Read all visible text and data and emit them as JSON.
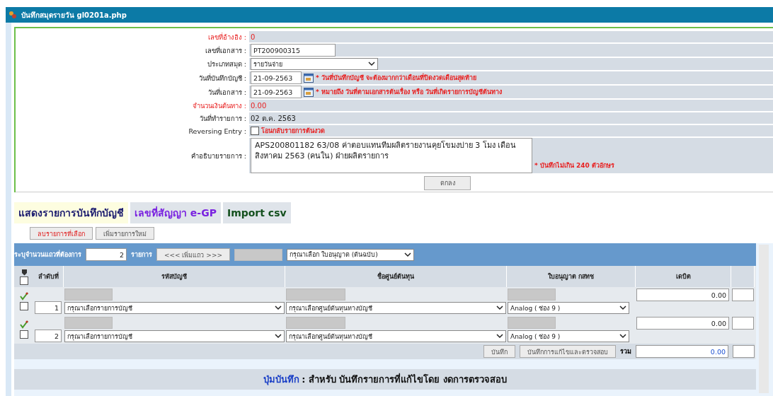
{
  "window": {
    "title": "บันทึกสมุดรายวัน gl0201a.php"
  },
  "form": {
    "fields": [
      {
        "kind": "readonly",
        "label": "เลขที่อ้างอิง :",
        "value": "0",
        "alert": true
      },
      {
        "kind": "input",
        "label": "เลขที่เอกสาร :",
        "value": "PT200900315"
      },
      {
        "kind": "select",
        "label": "ประเภทสมุด :",
        "value": "รายวันจ่าย"
      },
      {
        "kind": "date",
        "label": "วันที่บันทึกบัญชี :",
        "value": "21-09-2563",
        "note": "* วันที่บันทึกบัญชี จะต้องมากกว่าเดือนที่ปิดงวดเดือนสุดท้าย"
      },
      {
        "kind": "date",
        "label": "วันที่เอกสาร :",
        "value": "21-09-2563",
        "note": "* หมายถึง วันที่ตามเอกสารต้นเรื่อง หรือ วันที่เกิดรายการบัญชีต้นทาง"
      },
      {
        "kind": "readonly",
        "label": "จำนวนเงินต้นทาง :",
        "value": "0.00",
        "alert": true
      },
      {
        "kind": "readonly",
        "label": "วันที่ทำรายการ :",
        "value": "02 ต.ค. 2563",
        "alert": false
      },
      {
        "kind": "checkbox",
        "label": "Reversing Entry :",
        "checked": false,
        "caption": "โอนกลับรายการต้นงวด"
      },
      {
        "kind": "textarea",
        "label": "คำอธิบายรายการ :",
        "value": "APS200801182 63/08 ค่าตอบแทนทีมผลิตรายงานคุยโขมงบ่าย 3 โมง เดือนสิงหาคม 2563 (คนใน) ฝ่ายผลิตรายการ",
        "note": "* บันทึกไม่เกิน 240 ตัวอักษร"
      }
    ],
    "submit": "ตกลง"
  },
  "tabs": [
    {
      "label": "แสดงรายการบันทึกบัญชี",
      "selected": true,
      "color": "#1a1a6e"
    },
    {
      "label": "เลขที่สัญญา e-GP",
      "selected": false,
      "color": "#7a22e0"
    },
    {
      "label": "Import csv",
      "selected": false,
      "color": "#14501e"
    }
  ],
  "actions": [
    {
      "label": "ลบรายการที่เลือก",
      "kind": "danger"
    },
    {
      "label": "เพิ่มรายการใหม่",
      "kind": "normal"
    }
  ],
  "row_adder": {
    "label": "ระบุจำนวนแถวที่ต้องการ",
    "count": "2",
    "unit": "รายการ",
    "button": "<<< เพิ่มแถว >>>",
    "license_select": "กรุณาเลือก ใบอนุญาต (ต้นฉบับ)"
  },
  "table": {
    "select_all": false,
    "columns": [
      "ลำดับที่",
      "รหัสบัญชี",
      "ชื่อศูนย์ต้นทุน",
      "ใบอนุญาต กสทช",
      "เดบิต"
    ],
    "rows": [
      {
        "checked": false,
        "number": "1",
        "account": "กรุณาเลือกรายการบัญชี",
        "cost_center": "กรุณาเลือกศูนย์ต้นทุนทางบัญชี",
        "license": "Analog ( ช่อง 9 )",
        "debit": "0.00"
      },
      {
        "checked": false,
        "number": "2",
        "account": "กรุณาเลือกรายการบัญชี",
        "cost_center": "กรุณาเลือกศูนย์ต้นทุนทางบัญชี",
        "license": "Analog ( ช่อง 9 )",
        "debit": "0.00"
      }
    ],
    "footer": {
      "buttons": [
        "บันทึก",
        "บันทึกการแก้ไขและตรวจสอบ"
      ],
      "total_label": "รวม",
      "total": "0.00"
    }
  },
  "note": {
    "term": "ปุ่มบันทึก",
    "text": ": สำหรับ บันทึกรายการที่แก้ไขโดย งดการตรวจสอบ"
  }
}
